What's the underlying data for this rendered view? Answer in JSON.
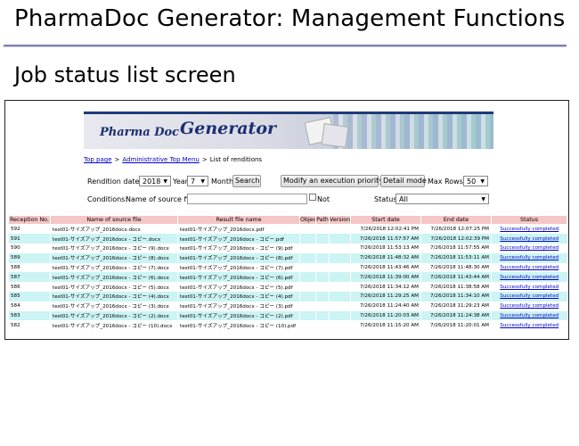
{
  "page": {
    "title": "PharmaDoc Generator: Management Functions",
    "section": "Job status list screen"
  },
  "brand": {
    "pharma": "Pharma Doc",
    "generator": "Generator"
  },
  "breadcrumb": {
    "top": "Top page",
    "admin": "Administrative Top Menu",
    "current": "List of renditions",
    "sep": ">"
  },
  "controls": {
    "rendition_date_label": "Rendition date:",
    "year_value": "2018",
    "year_label": "Year",
    "month_value": "7",
    "month_label": "Month",
    "search_label": "Search",
    "priority_label": "Modify an execution priority",
    "detail_label": "Detail mode",
    "maxrows_label": "Max Rows:",
    "maxrows_value": "50",
    "conditions_label": "Conditions:",
    "source_label": "Name of source file",
    "source_value": "",
    "not_label": "Not",
    "status_label": "Status",
    "status_value": "All"
  },
  "table": {
    "headers": [
      "Reception No.",
      "Name of source file",
      "Result file name",
      "Object ID",
      "Path",
      "Version",
      "Start date",
      "End date",
      "Status"
    ],
    "rows": [
      {
        "no": "592",
        "src": "test01-サイズアップ_2016docx.docx",
        "res": "test01-サイズアップ_2016docx.pdf",
        "start": "7/26/2018 12:02:41 PM",
        "end": "7/26/2018 12:07:25 PM",
        "status": "Successfully completed"
      },
      {
        "no": "591",
        "src": "test01-サイズアップ_2016docx - コピー.docx",
        "res": "test01-サイズアップ_2016docx - コピー.pdf",
        "start": "7/26/2018 11:57:57 AM",
        "end": "7/26/2018 12:02:39 PM",
        "status": "Successfully completed"
      },
      {
        "no": "590",
        "src": "test01-サイズアップ_2016docx - コピー (9).docx",
        "res": "test01-サイズアップ_2016docx - コピー (9).pdf",
        "start": "7/26/2018 11:53:13 AM",
        "end": "7/26/2018 11:57:55 AM",
        "status": "Successfully completed"
      },
      {
        "no": "589",
        "src": "test01-サイズアップ_2016docx - コピー (8).docx",
        "res": "test01-サイズアップ_2016docx - コピー (8).pdf",
        "start": "7/26/2018 11:48:32 AM",
        "end": "7/26/2018 11:53:11 AM",
        "status": "Successfully completed"
      },
      {
        "no": "588",
        "src": "test01-サイズアップ_2016docx - コピー (7).docx",
        "res": "test01-サイズアップ_2016docx - コピー (7).pdf",
        "start": "7/26/2018 11:43:46 AM",
        "end": "7/26/2018 11:48:30 AM",
        "status": "Successfully completed"
      },
      {
        "no": "587",
        "src": "test01-サイズアップ_2016docx - コピー (6).docx",
        "res": "test01-サイズアップ_2016docx - コピー (6).pdf",
        "start": "7/26/2018 11:39:00 AM",
        "end": "7/26/2018 11:43:44 AM",
        "status": "Successfully completed"
      },
      {
        "no": "586",
        "src": "test01-サイズアップ_2016docx - コピー (5).docx",
        "res": "test01-サイズアップ_2016docx - コピー (5).pdf",
        "start": "7/26/2018 11:34:12 AM",
        "end": "7/26/2018 11:38:58 AM",
        "status": "Successfully completed"
      },
      {
        "no": "585",
        "src": "test01-サイズアップ_2016docx - コピー (4).docx",
        "res": "test01-サイズアップ_2016docx - コピー (4).pdf",
        "start": "7/26/2018 11:29:25 AM",
        "end": "7/26/2018 11:34:10 AM",
        "status": "Successfully completed"
      },
      {
        "no": "584",
        "src": "test01-サイズアップ_2016docx - コピー (3).docx",
        "res": "test01-サイズアップ_2016docx - コピー (3).pdf",
        "start": "7/26/2018 11:24:40 AM",
        "end": "7/26/2018 11:29:23 AM",
        "status": "Successfully completed"
      },
      {
        "no": "583",
        "src": "test01-サイズアップ_2016docx - コピー (2).docx",
        "res": "test01-サイズアップ_2016docx - コピー (2).pdf",
        "start": "7/26/2018 11:20:03 AM",
        "end": "7/26/2018 11:24:38 AM",
        "status": "Successfully completed"
      },
      {
        "no": "582",
        "src": "test01-サイズアップ_2016docx - コピー (10).docx",
        "res": "test01-サイズアップ_2016docx - コピー (10).pdf",
        "start": "7/26/2018 11:15:20 AM",
        "end": "7/26/2018 11:20:01 AM",
        "status": "Successfully completed"
      }
    ]
  },
  "colors": {
    "header_bg": "#f4c6c6",
    "row_alt": "#ccf4f4",
    "link": "#0000cc",
    "rule": "#7f7fb2"
  }
}
